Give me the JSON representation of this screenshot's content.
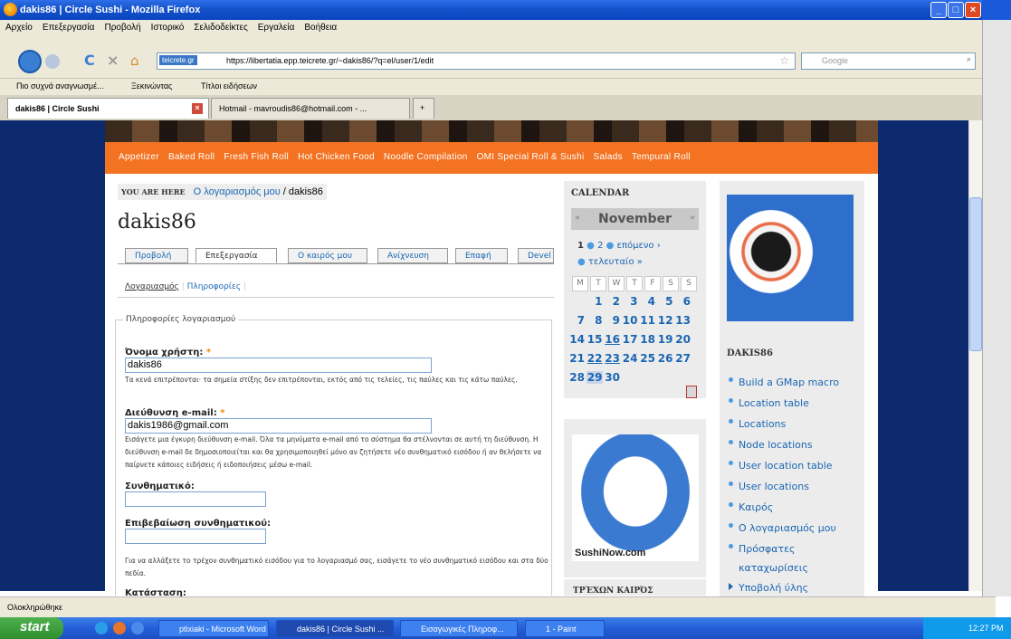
{
  "window": {
    "title": "dakis86 | Circle Sushi - Mozilla Firefox"
  },
  "menu": [
    "Αρχείο",
    "Επεξεργασία",
    "Προβολή",
    "Ιστορικό",
    "Σελιδοδείκτες",
    "Εργαλεία",
    "Βοήθεια"
  ],
  "address": {
    "site_tag": "teicrete.gr",
    "url": "https://libertatia.epp.teicrete.gr/~dakis86/?q=el/user/1/edit",
    "search_placeholder": "Google"
  },
  "bookmarks": [
    "Πιο συχνά αναγνωσμέ...",
    "Ξεκινώντας",
    "Τίτλοι ειδήσεων"
  ],
  "tabs": [
    {
      "label": "dakis86 | Circle Sushi",
      "active": true
    },
    {
      "label": "Hotmail - mavroudis86@hotmail.com - ...",
      "active": false
    }
  ],
  "site": {
    "nav": [
      "Appetizer",
      "Baked Roll",
      "Fresh Fish Roll",
      "Hot Chicken Food",
      "Noodle Compilation",
      "OMI Special Roll & Sushi",
      "Salads",
      "Tempural Roll"
    ],
    "you_are_here": "YOU ARE HERE",
    "breadcrumb_link": "Ο λογαριασμός μου",
    "breadcrumb_current": "/ dakis86",
    "page_title": "dakis86",
    "page_tabs": [
      "Προβολή",
      "Επεξεργασία",
      "Ο καιρός μου",
      "Ανίχνευση",
      "Επαφή",
      "Devel"
    ],
    "subtabs": [
      "Λογαριασμός",
      "Πληροφορίες"
    ],
    "legend": "Πληροφορίες λογαριασμού",
    "username_label": "Όνομα χρήστη:",
    "username_value": "dakis86",
    "username_desc": "Τα κενά επιτρέπονται· τα σημεία στίξης δεν επιτρέπονται, εκτός από τις τελείες, τις παύλες και τις κάτω παύλες.",
    "email_label": "Διεύθυνση e-mail:",
    "email_value": "dakis1986@gmail.com",
    "email_desc": "Εισάγετε μια έγκυρη διεύθυνση e-mail. Όλα τα μηνύματα e-mail από το σύστημα θα στέλνονται σε αυτή τη διεύθυνση. Η διεύθυνση e-mail δε δημοσιοποιείται και θα χρησιμοποιηθεί μόνο αν ζητήσετε νέο συνθηματικό εισόδου ή αν θελήσετε να παίρνετε κάποιες ειδήσεις ή ειδοποιήσεις μέσω e-mail.",
    "password_label": "Συνθηματικό:",
    "confirm_label": "Επιβεβαίωση συνθηματικού:",
    "password_desc": "Για να αλλάξετε το τρέχον συνθηματικό εισόδου για το λογαριασμό σας, εισάγετε το νέο συνθηματικό εισόδου και στα δύο πεδία.",
    "status_label": "Κατάσταση:"
  },
  "calendar": {
    "heading": "CALENDAR",
    "month": "November",
    "pager": [
      "1",
      "2",
      "επόμενο ›",
      "τελευταίο »"
    ],
    "dow": [
      "M",
      "T",
      "W",
      "T",
      "F",
      "S",
      "S"
    ],
    "weeks": [
      [
        "",
        "",
        "",
        "1",
        "2",
        "3",
        "4",
        "5",
        "6"
      ],
      [
        "7",
        "8",
        "9",
        "10",
        "11",
        "12",
        "13"
      ],
      [
        "14",
        "15",
        "16",
        "17",
        "18",
        "19",
        "20"
      ],
      [
        "21",
        "22",
        "23",
        "24",
        "25",
        "26",
        "27"
      ],
      [
        "28",
        "29",
        "30"
      ]
    ]
  },
  "promo": {
    "caption": "SushiNow.com"
  },
  "weather_heading": "ΤΡΈΧΩΝ ΚΑΙΡΌΣ",
  "sidebar": {
    "heading": "DAKIS86",
    "items": [
      "Build a GMap macro",
      "Location table",
      "Locations",
      "Node locations",
      "User location table",
      "User locations",
      "Καιρός",
      "Ο λογαριασμός μου",
      "Πρόσφατες καταχωρίσεις",
      "Υποβολή ύλης"
    ]
  },
  "status": "Ολοκληρώθηκε",
  "taskbar": {
    "start": "start",
    "tasks": [
      "ptixiaki - Microsoft Word",
      "dakis86 | Circle Sushi ...",
      "Εισαγωγικές Πληροφ...",
      "1 - Paint"
    ],
    "clock": "12:27 PM"
  }
}
